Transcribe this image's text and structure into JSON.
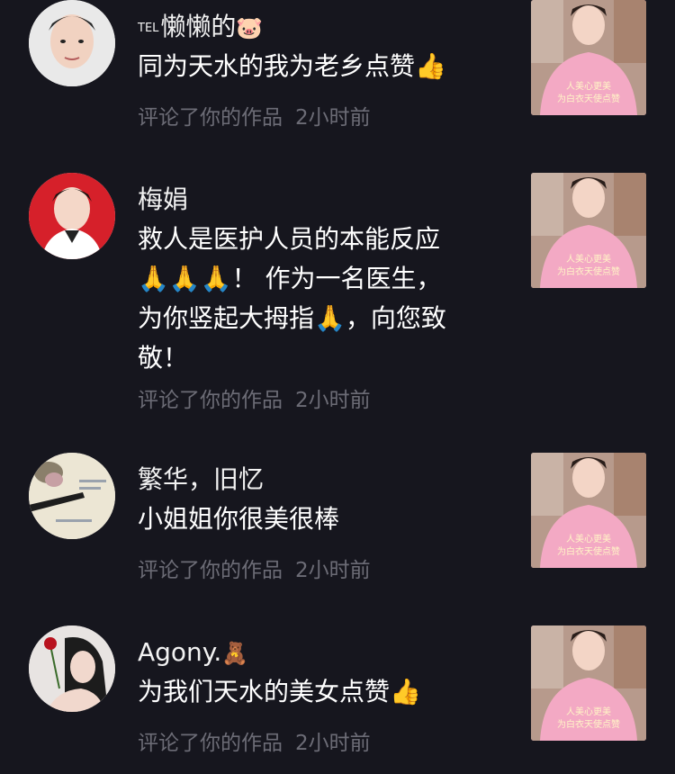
{
  "comments": [
    {
      "tel_prefix": "TEL",
      "username": "懒懒的",
      "username_emoji": "🐷",
      "lines": [
        "同为天水的我为老乡点赞👍"
      ],
      "action": "评论了你的作品",
      "time": "2小时前",
      "thumb_caption": [
        "人美心更美",
        "为白衣天使点赞"
      ]
    },
    {
      "username": "梅娟",
      "lines": [
        "救人是医护人员的本能反应",
        "🙏🙏🙏！ 作为一名医生，",
        "为你竖起大拇指🙏，向您致",
        "敬！"
      ],
      "action": "评论了你的作品",
      "time": "2小时前",
      "thumb_caption": [
        "人美心更美",
        "为白衣天使点赞"
      ]
    },
    {
      "username": "繁华，旧忆",
      "lines": [
        "小姐姐你很美很棒"
      ],
      "action": "评论了你的作品",
      "time": "2小时前",
      "thumb_caption": [
        "人美心更美",
        "为白衣天使点赞"
      ]
    },
    {
      "username": "Agony.",
      "username_emoji": "🧸",
      "lines": [
        "为我们天水的美女点赞👍"
      ],
      "action": "评论了你的作品",
      "time": "2小时前",
      "thumb_caption": [
        "人美心更美",
        "为白衣天使点赞"
      ]
    }
  ],
  "colors": {
    "background": "#16161e",
    "meta_text": "#6c6c76",
    "thumb_pink": "#f3a9c4"
  }
}
